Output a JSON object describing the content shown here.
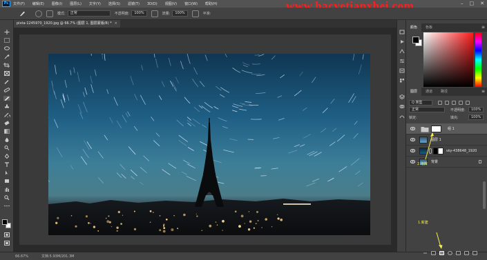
{
  "menubar": {
    "logo": "Ps",
    "items": [
      "文件(F)",
      "编辑(E)",
      "图像(I)",
      "图层(L)",
      "文字(Y)",
      "选择(S)",
      "滤镜(T)",
      "3D(D)",
      "视图(V)",
      "窗口(W)",
      "帮助(H)"
    ],
    "watermark": "www.hacyetianxhei.com"
  },
  "options": {
    "mode_label": "模式:",
    "mode_value": "正常",
    "opacity_label": "不透明度:",
    "opacity_value": "100%",
    "flow_label": "流量:",
    "flow_value": "100%",
    "smooth_label": "平滑:"
  },
  "document": {
    "tab_title": "pixta-1245970_1920.jpg @ 66.7% (图层 1, 图层蒙版/8) *",
    "zoom": "66.67%",
    "doc_size": "文档:5.93M/201.3M"
  },
  "panels": {
    "color_tabs": [
      "颜色",
      "色板"
    ],
    "layer_tabs": [
      "图层",
      "通道",
      "路径"
    ],
    "filter_kind": "Q 类型",
    "blend_mode": "正常",
    "opacity_label": "不透明度:",
    "opacity_value": "100%",
    "lock_label": "锁定:",
    "fill_label": "填充:",
    "fill_value": "100%",
    "layers": [
      {
        "name": "组 1",
        "type": "group",
        "selected": true
      },
      {
        "name": "图层 1",
        "type": "layer",
        "selected": false
      },
      {
        "name": "sky-438648_1920",
        "type": "layer",
        "selected": false
      },
      {
        "name": "背景",
        "type": "background",
        "selected": false
      }
    ],
    "annotation_drag": "2.拖拽",
    "annotation_new": "1.新建"
  },
  "colors": {
    "annotation": "#f5f04a",
    "watermark": "#ff1e1e"
  }
}
